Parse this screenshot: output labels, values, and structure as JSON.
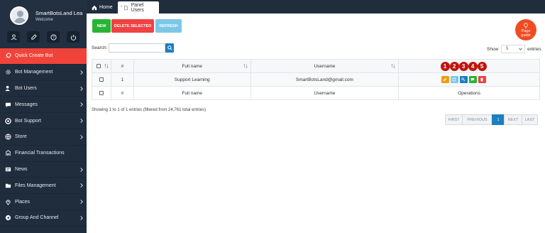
{
  "profile": {
    "name": "SmartBotsLand Lea",
    "welcome": "Welcome"
  },
  "sidebar": {
    "actions": [
      "users-icon",
      "edit-icon",
      "help-icon",
      "power-icon"
    ],
    "items": [
      {
        "label": "Quick Create Bot",
        "icon": "rocket-icon",
        "active": true,
        "chevron": false
      },
      {
        "label": "Bot Management",
        "icon": "gear-icon",
        "chevron": true
      },
      {
        "label": "Bot Users",
        "icon": "users-icon",
        "chevron": true
      },
      {
        "label": "Messages",
        "icon": "messages-icon",
        "chevron": true
      },
      {
        "label": "Bot Support",
        "icon": "support-icon",
        "chevron": true
      },
      {
        "label": "Store",
        "icon": "store-icon",
        "chevron": true
      },
      {
        "label": "Financial Transactions",
        "icon": "wallet-icon",
        "chevron": false
      },
      {
        "label": "News",
        "icon": "news-icon",
        "chevron": true
      },
      {
        "label": "Files Management",
        "icon": "files-icon",
        "chevron": true
      },
      {
        "label": "Places",
        "icon": "pin-icon",
        "chevron": true
      },
      {
        "label": "Group And Channel",
        "icon": "group-icon",
        "chevron": true
      }
    ]
  },
  "tabs": {
    "home": "Home",
    "panel": "Panel Users"
  },
  "toolbar": {
    "new": "NEW",
    "delete": "DELETE SELECTED",
    "refresh": "REFRESH"
  },
  "guide": {
    "line1": "Page",
    "line2": "guide"
  },
  "search": {
    "label": "Search:",
    "value": ""
  },
  "length": {
    "show": "Show",
    "value": "5",
    "entries": "entries"
  },
  "table": {
    "columns": [
      "",
      "#",
      "Full name",
      "Username",
      "Operations"
    ],
    "rows": [
      {
        "num": "1",
        "full_name": "Support Learning",
        "username": "SmartBotsLand@gmail.com"
      }
    ],
    "footer": [
      "",
      "#",
      "Full name",
      "Username",
      "Operations"
    ],
    "operations": [
      {
        "icon": "edit-icon",
        "color": "#f39c12",
        "badge": "1"
      },
      {
        "icon": "copy-icon",
        "color": "#7fc6e8",
        "badge": "2"
      },
      {
        "icon": "key-icon",
        "color": "#1c7fbf",
        "badge": "3"
      },
      {
        "icon": "message-icon",
        "color": "#28b535",
        "badge": "4"
      },
      {
        "icon": "trash-icon",
        "color": "#ef4242",
        "badge": "5"
      }
    ]
  },
  "info": "Showing 1 to 1 of 1 entries (filtered from 24,761 total entries)",
  "pager": {
    "first": "FIRST",
    "previous": "PREVIOUS",
    "current": "1",
    "next": "NEXT",
    "last": "LAST"
  },
  "colors": {
    "sidebar": "#1f2d3d",
    "active": "#f0443a",
    "primary": "#1c7fbf",
    "success": "#28b535",
    "danger": "#ef4242",
    "badge": "#c0140c"
  }
}
